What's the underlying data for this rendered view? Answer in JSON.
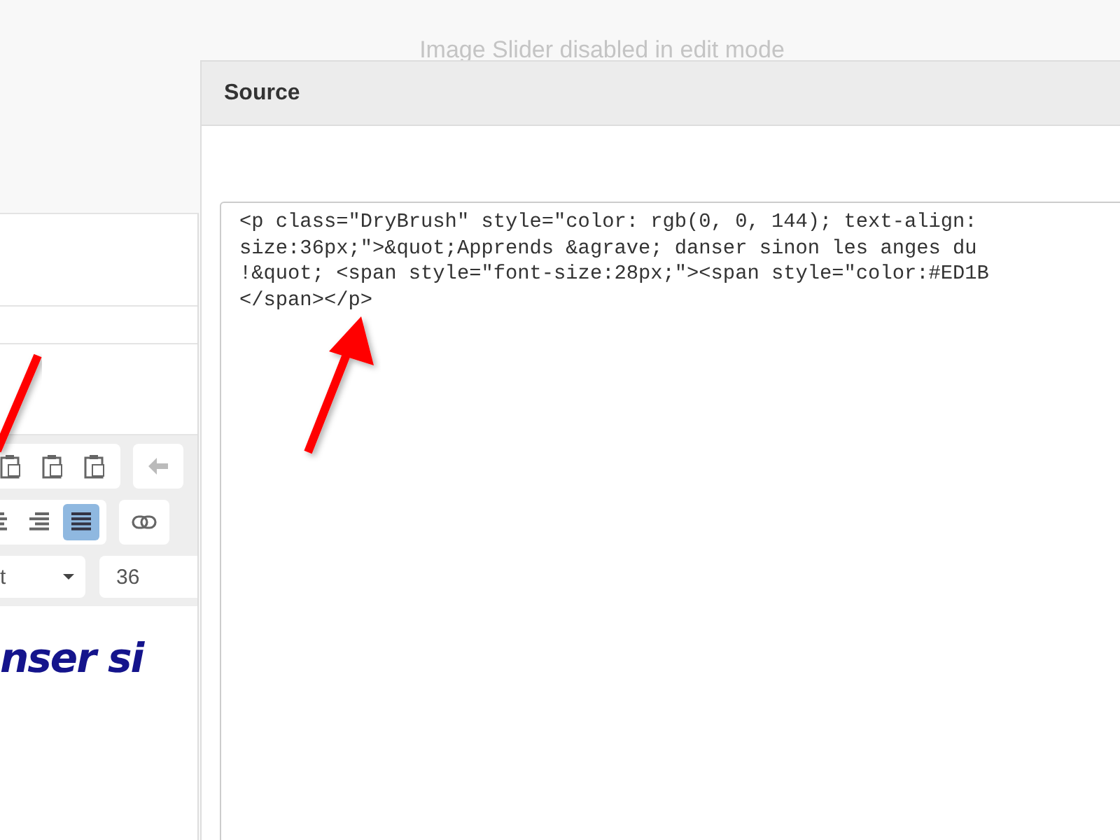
{
  "notice": "Image Slider disabled in edit mode",
  "editor": {
    "toolbar_rows": [
      {
        "buttons": [
          {
            "kind": "paste-text",
            "selected": false
          },
          {
            "kind": "paste-plain",
            "selected": false
          },
          {
            "kind": "paste-word",
            "selected": false
          }
        ],
        "next_group": [
          {
            "kind": "undo",
            "selected": false
          }
        ]
      },
      {
        "buttons": [
          {
            "kind": "align-center",
            "selected": false
          },
          {
            "kind": "align-right",
            "selected": false
          },
          {
            "kind": "justify",
            "selected": true
          }
        ],
        "next_group": [
          {
            "kind": "link",
            "selected": false
          }
        ]
      }
    ],
    "font_select": "t",
    "size_field": "36",
    "content": "nser si"
  },
  "dialog": {
    "title": "Source",
    "code_lines": [
      "<p class=\"DryBrush\" style=\"color: rgb(0, 0, 144); text-align:",
      "size:36px;\">&quot;Apprends &agrave; danser sinon les anges du",
      "!&quot; <span style=\"font-size:28px;\"><span style=\"color:#ED1B",
      "</span></p>"
    ]
  }
}
